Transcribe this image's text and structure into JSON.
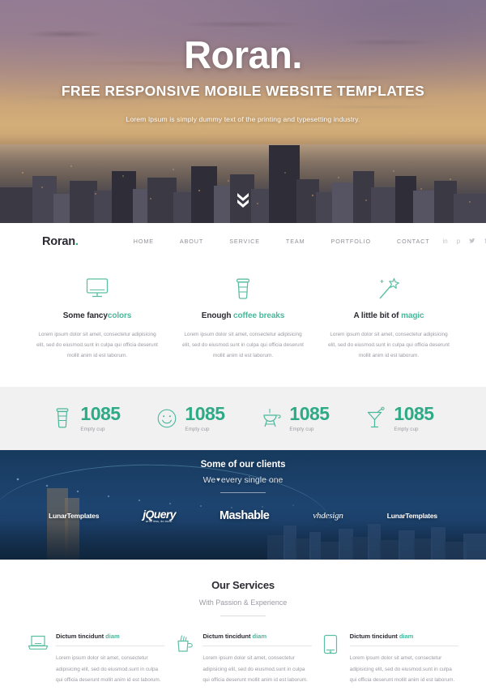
{
  "hero": {
    "title": "Roran.",
    "subtitle": "FREE RESPONSIVE MOBILE WEBSITE TEMPLATES",
    "lead": "Lorem Ipsum is simply dummy text of the printing and typesetting industry.",
    "scroll_icon": "chevron-double-down-icon"
  },
  "navbar": {
    "logo_text": "Roran",
    "logo_dot": ".",
    "links": [
      {
        "label": "HOME"
      },
      {
        "label": "ABOUT"
      },
      {
        "label": "SERVICE"
      },
      {
        "label": "TEAM"
      },
      {
        "label": "PORTFOLIO"
      },
      {
        "label": "CONTACT"
      }
    ],
    "socials": [
      {
        "name": "linkedin-icon",
        "glyph": "in"
      },
      {
        "name": "pinterest-icon",
        "glyph": "p"
      },
      {
        "name": "twitter-icon",
        "glyph": "ᴠ"
      },
      {
        "name": "facebook-icon",
        "glyph": "f"
      }
    ]
  },
  "features": [
    {
      "icon": "monitor-icon",
      "title_plain": "Some fancy",
      "title_accent": "colors",
      "text": "Lorem ipsum dolor sit amet, consectetur adipisicing elit, sed do eiusmod.sunt in culpa qui officia deserunt mollit anim id est laborum."
    },
    {
      "icon": "coffee-cup-icon",
      "title_plain": "Enough ",
      "title_accent": "coffee breaks",
      "text": "Lorem ipsum dolor sit amet, consectetur adipisicing elit, sed do eiusmod.sunt in culpa qui officia deserunt mollit anim id est laborum."
    },
    {
      "icon": "magic-wand-icon",
      "title_plain": "A little bit of ",
      "title_accent": "magic",
      "text": "Lorem ipsum dolor sit amet, consectetur adipisicing elit, sed do eiusmod.sunt in culpa qui officia deserunt mollit anim id est laborum."
    }
  ],
  "stats": [
    {
      "icon": "coffee-cup-icon",
      "value": "1085",
      "label": "Empty cup"
    },
    {
      "icon": "smiley-face-icon",
      "value": "1085",
      "label": "Empty cup"
    },
    {
      "icon": "bbq-grill-icon",
      "value": "1085",
      "label": "Empty cup"
    },
    {
      "icon": "cocktail-glass-icon",
      "value": "1085",
      "label": "Empty cup"
    }
  ],
  "clients": {
    "title": "Some of our clients",
    "subtitle_before": "We",
    "subtitle_heart": "♥",
    "subtitle_after": "every single one",
    "logos": [
      {
        "name": "lunartemplates-logo",
        "text": "LunarTemplates"
      },
      {
        "name": "jquery-logo",
        "text": "jQuery",
        "tagline": "write less, do more."
      },
      {
        "name": "mashable-logo",
        "text": "Mashable"
      },
      {
        "name": "vhdesign-logo",
        "text": "vhdesign"
      },
      {
        "name": "lunartemplates-logo-2",
        "text": "LunarTemplates"
      }
    ]
  },
  "services": {
    "title": "Our Services",
    "subtitle": "With Passion & Experience",
    "items": [
      {
        "icon": "laptop-icon",
        "title_plain": "Dictum tincidunt ",
        "title_accent": "diam",
        "text": "Lorem ipsum dolor sit amet, consectetur adipisicing elit, sed do eiusmod.sunt in culpa qui officia deserunt mollit anim id est laborum."
      },
      {
        "icon": "pencil-cup-icon",
        "title_plain": "Dictum tincidunt ",
        "title_accent": "diam",
        "text": "Lorem ipsum dolor sit amet, consectetur adipisicing elit, sed do eiusmod.sunt in culpa qui officia deserunt mollit anim id est laborum."
      },
      {
        "icon": "tablet-icon",
        "title_plain": "Dictum tincidunt ",
        "title_accent": "diam",
        "text": "Lorem ipsum dolor sit amet, consectetur adipisicing elit, sed do eiusmod.sunt in culpa qui officia deserunt mollit anim id est laborum."
      }
    ]
  },
  "colors": {
    "accent_teal": "#4ab79b",
    "accent_teal_dark": "#2faa86",
    "dark_navy": "#1b4068",
    "text_dark": "#2b2b33",
    "text_muted": "#9a9aa2",
    "stats_bg": "#f1f1f1"
  }
}
